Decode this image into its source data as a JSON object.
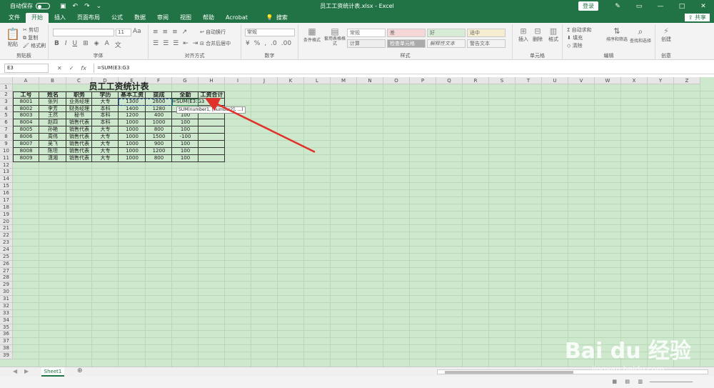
{
  "titlebar": {
    "autosave": "自动保存",
    "doc_title": "员工工资统计表.xlsx  -  Excel",
    "login": "登录"
  },
  "tabs": [
    "文件",
    "开始",
    "插入",
    "页面布局",
    "公式",
    "数据",
    "审阅",
    "视图",
    "帮助",
    "Acrobat"
  ],
  "search": "搜索",
  "share": "共享",
  "ribbon": {
    "paste": "粘贴",
    "cut": "剪切",
    "copy": "复制",
    "format_painter": "格式刷",
    "clipboard": "剪贴板",
    "font_size": "11",
    "font_group": "字体",
    "wrap": "自动换行",
    "merge": "合并后居中",
    "alignment": "对齐方式",
    "number_format": "常规",
    "number_group": "数字",
    "cond_format": "条件格式",
    "table_format": "套用表格格式",
    "styles": [
      "常规",
      "差",
      "好",
      "适中",
      "计算",
      "检查单元格",
      "解释性文本",
      "警告文本"
    ],
    "styles_group": "样式",
    "insert": "插入",
    "delete": "删除",
    "format": "格式",
    "cells_group": "单元格",
    "autosum": "自动求和",
    "fill": "填充",
    "clear": "清除",
    "sort": "排序和筛选",
    "find": "查找和选择",
    "edit_group": "编辑",
    "create": "创建",
    "create_group": "创意"
  },
  "formula_bar": {
    "name_box": "E3",
    "formula": "=SUM(E3:G3"
  },
  "columns": [
    "A",
    "B",
    "C",
    "D",
    "E",
    "F",
    "G",
    "H",
    "I",
    "J",
    "K",
    "L",
    "M",
    "N",
    "O",
    "P",
    "Q",
    "R",
    "S",
    "T",
    "U",
    "V",
    "W",
    "X",
    "Y",
    "Z"
  ],
  "rows": [
    "1",
    "2",
    "3",
    "4",
    "5",
    "6",
    "7",
    "8",
    "9",
    "10",
    "11",
    "12",
    "13",
    "14",
    "15",
    "16",
    "17",
    "18",
    "19",
    "20",
    "21",
    "22",
    "23",
    "24",
    "25",
    "26",
    "27",
    "28",
    "29",
    "30",
    "31",
    "32",
    "33",
    "34",
    "35",
    "36",
    "37",
    "38",
    "39"
  ],
  "table": {
    "title": "员工工资统计表",
    "headers": [
      "工号",
      "姓名",
      "职务",
      "学历",
      "基本工资",
      "提成",
      "全勤",
      "工资合计"
    ],
    "rows": [
      [
        "8001",
        "张列",
        "业务经理",
        "大专",
        "1300",
        "2600",
        "=SUM(E3:G3",
        ""
      ],
      [
        "8002",
        "李芳",
        "财务经理",
        "本科",
        "1400",
        "1280",
        "",
        ""
      ],
      [
        "8003",
        "王然",
        "秘书",
        "本科",
        "1200",
        "400",
        "100",
        ""
      ],
      [
        "8004",
        "赵四",
        "销售代表",
        "本科",
        "1000",
        "1000",
        "100",
        ""
      ],
      [
        "8005",
        "孙艳",
        "销售代表",
        "大专",
        "1000",
        "800",
        "100",
        ""
      ],
      [
        "8006",
        "周伟",
        "销售代表",
        "大专",
        "1000",
        "1500",
        "-100",
        ""
      ],
      [
        "8007",
        "吴飞",
        "销售代表",
        "大专",
        "1000",
        "900",
        "100",
        ""
      ],
      [
        "8008",
        "陈坦",
        "销售代表",
        "大专",
        "1000",
        "1200",
        "100",
        ""
      ],
      [
        "8009",
        "潇湘",
        "销售代表",
        "大专",
        "1000",
        "800",
        "100",
        ""
      ]
    ]
  },
  "tooltip": "SUM(number1, [number2], ...)",
  "sheet_tab": "Sheet1",
  "watermark": {
    "brand": "Bai du 经验",
    "url": "jingyan.baidu.com"
  }
}
